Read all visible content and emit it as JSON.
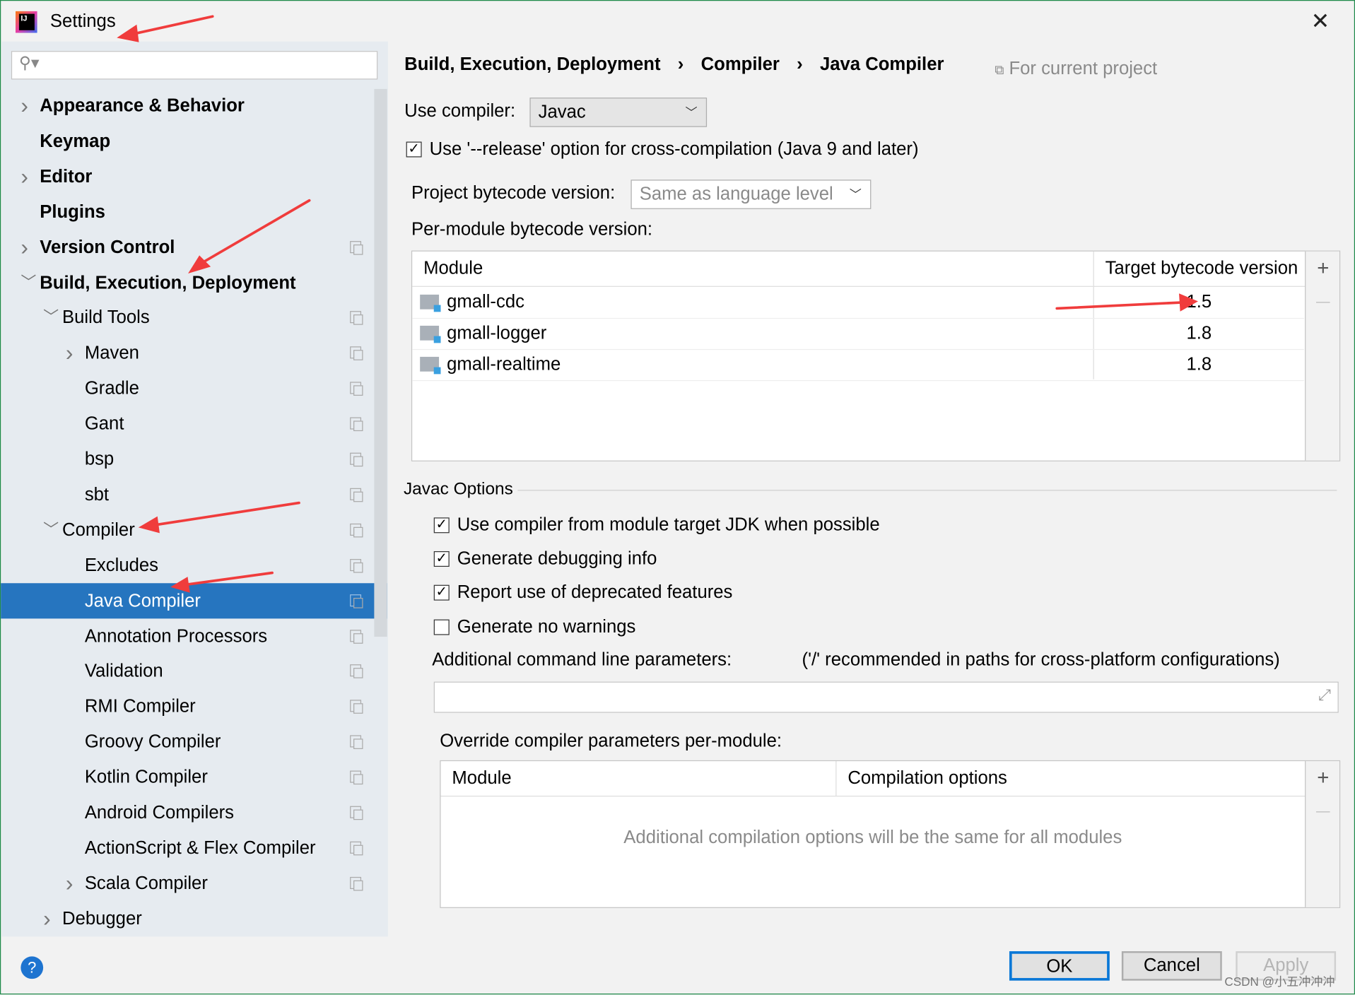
{
  "window": {
    "title": "Settings",
    "close_icon": "close-icon",
    "app_icon": "intellij-idea-logo"
  },
  "search": {
    "placeholder": "",
    "value": ""
  },
  "sidebar": {
    "items": [
      {
        "label": "Appearance & Behavior",
        "level": 0,
        "bold": true,
        "expandable": true,
        "expanded": false
      },
      {
        "label": "Keymap",
        "level": 0,
        "bold": true
      },
      {
        "label": "Editor",
        "level": 0,
        "bold": true,
        "expandable": true,
        "expanded": false
      },
      {
        "label": "Plugins",
        "level": 0,
        "bold": true
      },
      {
        "label": "Version Control",
        "level": 0,
        "bold": true,
        "expandable": true,
        "expanded": false,
        "project": true
      },
      {
        "label": "Build, Execution, Deployment",
        "level": 0,
        "bold": true,
        "expandable": true,
        "expanded": true
      },
      {
        "label": "Build Tools",
        "level": 1,
        "expandable": true,
        "expanded": true,
        "project": true
      },
      {
        "label": "Maven",
        "level": 2,
        "expandable": true,
        "expanded": false,
        "project": true
      },
      {
        "label": "Gradle",
        "level": 2,
        "project": true
      },
      {
        "label": "Gant",
        "level": 2,
        "project": true
      },
      {
        "label": "bsp",
        "level": 2,
        "project": true
      },
      {
        "label": "sbt",
        "level": 2,
        "project": true
      },
      {
        "label": "Compiler",
        "level": 1,
        "expandable": true,
        "expanded": true,
        "project": true
      },
      {
        "label": "Excludes",
        "level": 2,
        "project": true
      },
      {
        "label": "Java Compiler",
        "level": 2,
        "project": true,
        "selected": true
      },
      {
        "label": "Annotation Processors",
        "level": 2,
        "project": true
      },
      {
        "label": "Validation",
        "level": 2,
        "project": true
      },
      {
        "label": "RMI Compiler",
        "level": 2,
        "project": true
      },
      {
        "label": "Groovy Compiler",
        "level": 2,
        "project": true
      },
      {
        "label": "Kotlin Compiler",
        "level": 2,
        "project": true
      },
      {
        "label": "Android Compilers",
        "level": 2,
        "project": true
      },
      {
        "label": "ActionScript & Flex Compiler",
        "level": 2,
        "project": true
      },
      {
        "label": "Scala Compiler",
        "level": 2,
        "expandable": true,
        "expanded": false,
        "project": true
      },
      {
        "label": "Debugger",
        "level": 1,
        "expandable": true,
        "expanded": false
      }
    ]
  },
  "breadcrumb": {
    "items": [
      "Build, Execution, Deployment",
      "Compiler",
      "Java Compiler"
    ],
    "separator": "›",
    "scope": "For current project"
  },
  "use_compiler": {
    "label": "Use compiler:",
    "value": "Javac"
  },
  "release_option": {
    "label": "Use '--release' option for cross-compilation (Java 9 and later)",
    "checked": true
  },
  "project_bytecode": {
    "label": "Project bytecode version:",
    "value": "Same as language level"
  },
  "per_module": {
    "label": "Per-module bytecode version:",
    "columns": [
      "Module",
      "Target bytecode version"
    ],
    "rows": [
      {
        "module": "gmall-cdc",
        "version": "1.5"
      },
      {
        "module": "gmall-logger",
        "version": "1.8"
      },
      {
        "module": "gmall-realtime",
        "version": "1.8"
      }
    ],
    "add": "+",
    "remove": "—"
  },
  "javac": {
    "title": "Javac Options",
    "options": [
      {
        "label": "Use compiler from module target JDK when possible",
        "checked": true
      },
      {
        "label": "Generate debugging info",
        "checked": true
      },
      {
        "label": "Report use of deprecated features",
        "checked": true
      },
      {
        "label": "Generate no warnings",
        "checked": false
      }
    ],
    "params_label": "Additional command line parameters:",
    "params_hint": "('/' recommended in paths for cross-platform configurations)",
    "params_value": ""
  },
  "override": {
    "label": "Override compiler parameters per-module:",
    "columns": [
      "Module",
      "Compilation options"
    ],
    "empty_text": "Additional compilation options will be the same for all modules",
    "add": "+",
    "remove": "—"
  },
  "footer": {
    "help": "?",
    "ok": "OK",
    "cancel": "Cancel",
    "apply": "Apply",
    "watermark": "CSDN @小五冲冲冲"
  },
  "colors": {
    "selection": "#2675bf",
    "annotation_arrow": "#f03c3c",
    "ok_border": "#0a78d7"
  }
}
